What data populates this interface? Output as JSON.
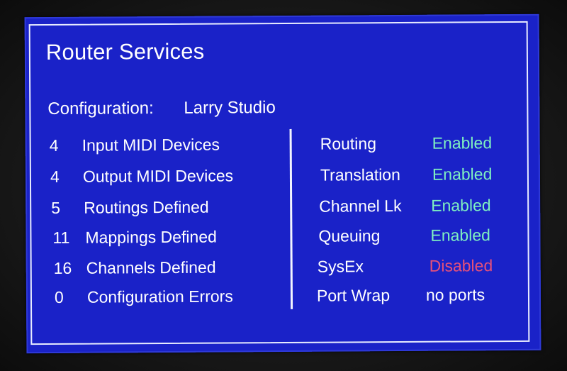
{
  "colors": {
    "background": "#1a22c8",
    "text": "#ffffff",
    "enabled": "#7ff0c0",
    "disabled": "#e4507a"
  },
  "title": "Router Services",
  "configuration": {
    "label": "Configuration:",
    "value": "Larry Studio"
  },
  "stats": [
    {
      "count": "4",
      "label": "Input MIDI Devices"
    },
    {
      "count": "4",
      "label": "Output MIDI Devices"
    },
    {
      "count": "5",
      "label": "Routings Defined"
    },
    {
      "count": "11",
      "label": "Mappings Defined"
    },
    {
      "count": "16",
      "label": "Channels Defined"
    },
    {
      "count": "0",
      "label": "Configuration Errors"
    }
  ],
  "services": [
    {
      "name": "Routing",
      "status": "Enabled"
    },
    {
      "name": "Translation",
      "status": "Enabled"
    },
    {
      "name": "Channel Lk",
      "status": "Enabled"
    },
    {
      "name": "Queuing",
      "status": "Enabled"
    },
    {
      "name": "SysEx",
      "status": "Disabled"
    },
    {
      "name": "Port Wrap",
      "status": "no ports"
    }
  ]
}
